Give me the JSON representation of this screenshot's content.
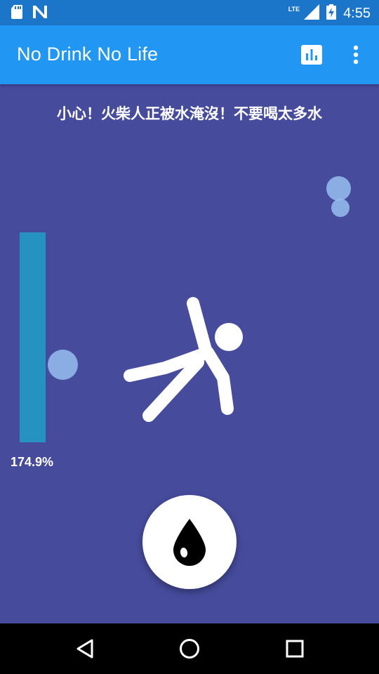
{
  "status_bar": {
    "time": "4:55",
    "network": "LTE",
    "icons": [
      "sd-card-icon",
      "notification-n-icon",
      "signal-icon",
      "battery-charging-icon"
    ]
  },
  "app_bar": {
    "title": "No Drink No Life",
    "actions": [
      "stats-icon",
      "more-vert-icon"
    ]
  },
  "main": {
    "warning": "小心！火柴人正被水淹沒！不要喝太多水",
    "gauge_value": "174.9%",
    "gauge_level": 1.749,
    "drink_button_icon": "water-drop-icon"
  },
  "nav_bar": {
    "icons": [
      "back-icon",
      "home-icon",
      "recents-icon"
    ]
  },
  "colors": {
    "status_bar": "#1b75c9",
    "app_bar": "#2196f3",
    "background": "#464b9c",
    "gauge": "#2592c1",
    "bubble": "#96bef0"
  }
}
